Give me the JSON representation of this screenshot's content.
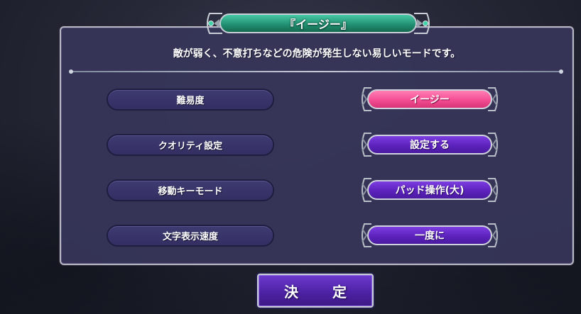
{
  "dialog": {
    "title": "『イージー』",
    "description": "敵が弱く、不意打ちなどの危険が発生しない易しいモードです。"
  },
  "settings": [
    {
      "label": "難易度",
      "value": "イージー",
      "style": "pink"
    },
    {
      "label": "クオリティ設定",
      "value": "設定する",
      "style": "purple"
    },
    {
      "label": "移動キーモード",
      "value": "パッド操作(大)",
      "style": "purple"
    },
    {
      "label": "文字表示速度",
      "value": "一度に",
      "style": "purple"
    }
  ],
  "confirm_label": "決　定",
  "colors": {
    "title_plate": "#239274",
    "selected_value": "#f44d93",
    "value_button": "#5c22bd",
    "panel": "#363558"
  }
}
